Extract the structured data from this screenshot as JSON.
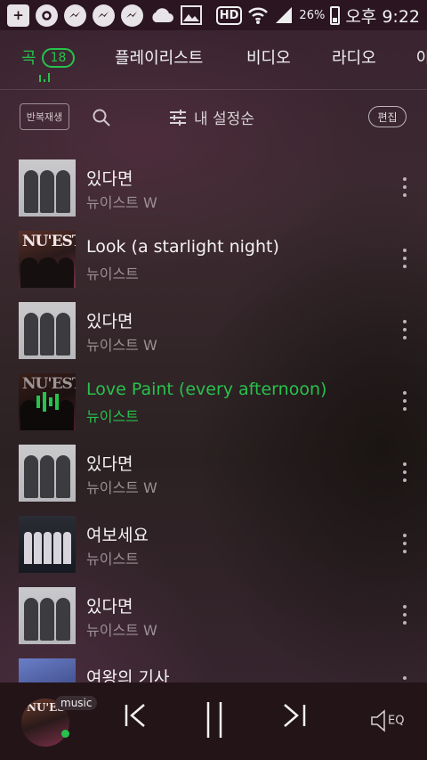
{
  "status_bar": {
    "left_icons": [
      "add-icon",
      "camera-icon",
      "messenger-icon",
      "messenger-icon",
      "messenger-icon",
      "cloud-icon",
      "image-icon"
    ],
    "hd_label": "HD",
    "battery_percent": "26%",
    "time": "오후 9:22"
  },
  "tabs": [
    {
      "label": "곡",
      "badge": "18",
      "active": true
    },
    {
      "label": "플레이리스트"
    },
    {
      "label": "비디오"
    },
    {
      "label": "라디오"
    },
    {
      "label": "아"
    }
  ],
  "toolbar": {
    "repeat_label": "반복재생",
    "sort_label": "내 설정순",
    "edit_label": "편집"
  },
  "songs": [
    {
      "title": "있다면",
      "artist": "뉴이스트 W",
      "art": "w"
    },
    {
      "title": "Look (a starlight night)",
      "artist": "뉴이스트",
      "art": "n"
    },
    {
      "title": "있다면",
      "artist": "뉴이스트 W",
      "art": "w"
    },
    {
      "title": "Love Paint (every afternoon)",
      "artist": "뉴이스트",
      "art": "n",
      "playing": true
    },
    {
      "title": "있다면",
      "artist": "뉴이스트 W",
      "art": "w"
    },
    {
      "title": "여보세요",
      "artist": "뉴이스트",
      "art": "b"
    },
    {
      "title": "있다면",
      "artist": "뉴이스트 W",
      "art": "w"
    },
    {
      "title": "여왕의 기사",
      "artist": "",
      "art": "q"
    }
  ],
  "player": {
    "tag": "music",
    "eq_label": "EQ",
    "accent_color": "#27c24c"
  }
}
